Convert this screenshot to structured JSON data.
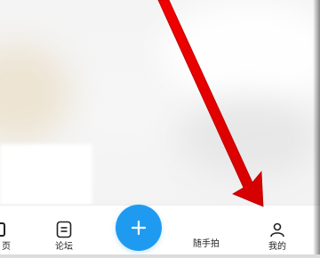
{
  "tabbar": {
    "partial_label": "页",
    "forum_label": "论坛",
    "snap_label": "随手拍",
    "mine_label": "我的"
  },
  "fab": {
    "icon": "plus-icon"
  },
  "icons": {
    "forum": "forum-icon",
    "home": "home-icon",
    "mine": "user-icon"
  },
  "colors": {
    "fab": "#1e9bf0",
    "annotation_arrow": "#e60000"
  }
}
